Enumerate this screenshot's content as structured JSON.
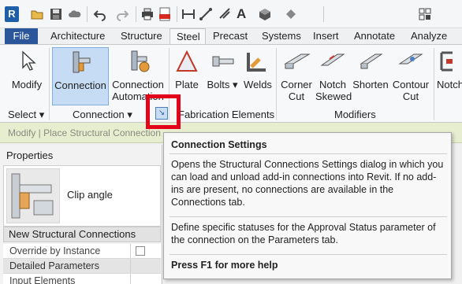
{
  "app": {
    "logo_letter": "R"
  },
  "qat": {
    "icons": [
      "open-icon",
      "save-icon",
      "cloud-icon",
      "undo-icon",
      "redo-icon",
      "print-icon",
      "pdf-icon",
      "measure-icon",
      "dimension-icon",
      "tag-icon",
      "text-icon",
      "view-3d-icon",
      "sync-icon",
      "windows-icon"
    ]
  },
  "tabs": [
    {
      "label": "File"
    },
    {
      "label": "Architecture"
    },
    {
      "label": "Structure"
    },
    {
      "label": "Steel",
      "active": true
    },
    {
      "label": "Precast"
    },
    {
      "label": "Systems"
    },
    {
      "label": "Insert"
    },
    {
      "label": "Annotate"
    },
    {
      "label": "Analyze"
    }
  ],
  "ribbon": {
    "buttons": {
      "modify": "Modify",
      "connection": "Connection",
      "connection_automation_1": "Connection",
      "connection_automation_2": "Automation",
      "plate": "Plate",
      "bolts": "Bolts",
      "welds": "Welds",
      "corner_cut_1": "Corner",
      "corner_cut_2": "Cut",
      "notch_skewed_1": "Notch",
      "notch_skewed_2": "Skewed",
      "shorten": "Shorten",
      "contour_cut_1": "Contour",
      "contour_cut_2": "Cut",
      "notch_more": "Notch"
    },
    "panels": {
      "select": "Select",
      "connection": "Connection",
      "fabrication": "Fabrication Elements",
      "modifiers": "Modifiers"
    },
    "dropdown_glyph": "▾",
    "launcher_glyph": "↘"
  },
  "mode_bar": {
    "text": "Modify | Place Structural Connection"
  },
  "properties": {
    "title": "Properties",
    "type_name": "Clip angle",
    "category": "New Structural Connections",
    "rows": [
      {
        "label": "Override by Instance"
      },
      {
        "label": "Detailed Parameters"
      },
      {
        "label": "Input Elements"
      }
    ]
  },
  "tooltip": {
    "title": "Connection Settings",
    "body": "Opens the Structural Connections Settings dialog in which you can load and unload add-in connections into Revit. If no add-ins are present, no connections are available in the Connections tab.",
    "extra": "Define specific statuses for the Approval Status parameter of the connection on the Parameters tab.",
    "help": "Press F1 for more help"
  },
  "colors": {
    "file_tab": "#2b579a",
    "selected_button": "#c5dcf4",
    "highlight_box": "#e3001b",
    "mode_bar": "#e7edcf"
  }
}
